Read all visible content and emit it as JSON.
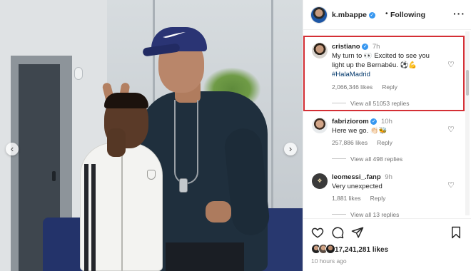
{
  "post": {
    "author": "k.mbappe",
    "following_label": "Following",
    "likes_count": "17,241,281 likes",
    "time_ago": "10 hours ago"
  },
  "comments": [
    {
      "user": "cristiano",
      "time": "7h",
      "text_part1": "My turn to 👀 Excited to see you light up the Bernabéu. ⚽💪",
      "hashtag": "#HalaMadrid",
      "likes": "2,066,346 likes",
      "reply_label": "Reply",
      "view_replies": "View all 51053 replies"
    },
    {
      "user": "fabriziorom",
      "time": "10h",
      "text_part1": "Here we go. 👏🏻🐝",
      "hashtag": "",
      "likes": "257,886 likes",
      "reply_label": "Reply",
      "view_replies": "View all 498 replies"
    },
    {
      "user": "leomessi_.fanp",
      "time": "9h",
      "text_part1": "Very unexpected",
      "hashtag": "",
      "likes": "1,881 likes",
      "reply_label": "Reply",
      "view_replies": "View all 13 replies"
    }
  ],
  "icons": {
    "like": "heart-icon",
    "comment": "comment-icon",
    "share": "share-icon",
    "save": "bookmark-icon",
    "verified": "verified-badge-icon",
    "more": "more-options-icon"
  },
  "colors": {
    "verified": "#3797f0",
    "highlight_box": "#d42f35",
    "hashtag": "#00376b",
    "muted_text": "#737373"
  }
}
